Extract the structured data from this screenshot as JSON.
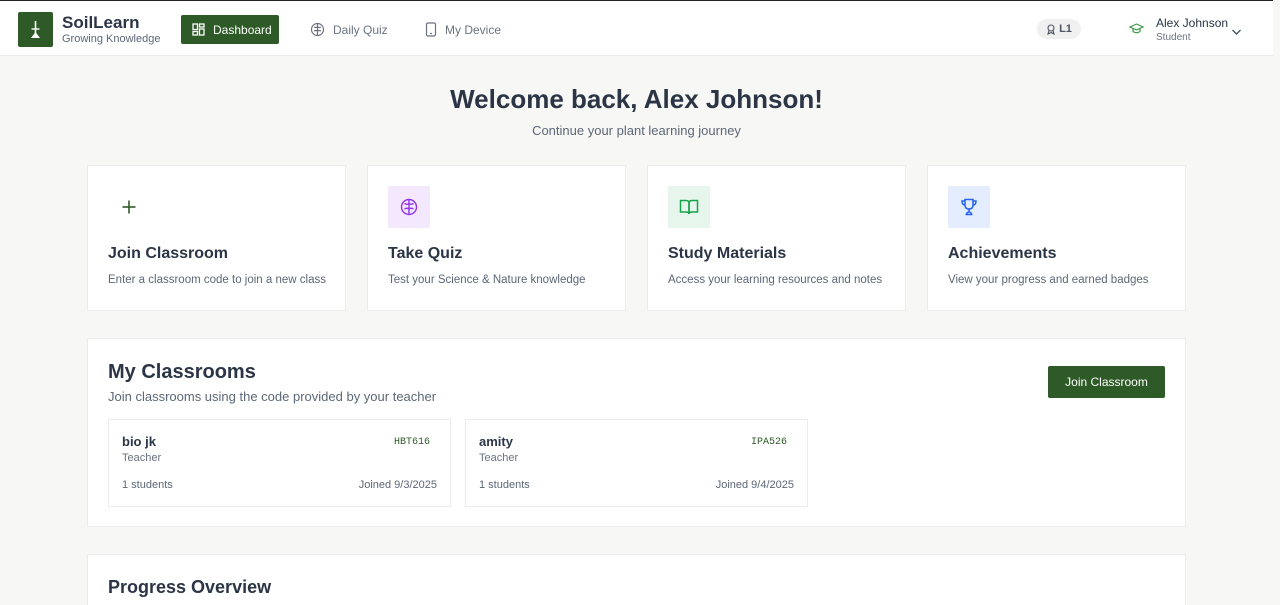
{
  "app": {
    "name": "SoilLearn",
    "tagline": "Growing Knowledge"
  },
  "nav": {
    "dashboard": "Dashboard",
    "daily_quiz": "Daily Quiz",
    "my_device": "My Device"
  },
  "user": {
    "level": "L1",
    "name": "Alex Johnson",
    "role": "Student"
  },
  "welcome": {
    "title": "Welcome back, Alex Johnson!",
    "subtitle": "Continue your plant learning journey"
  },
  "actions": [
    {
      "title": "Join Classroom",
      "desc": "Enter a classroom code to join a new class",
      "icon": "plus-icon"
    },
    {
      "title": "Take Quiz",
      "desc": "Test your Science & Nature knowledge",
      "icon": "brain-icon"
    },
    {
      "title": "Study Materials",
      "desc": "Access your learning resources and notes",
      "icon": "book-icon"
    },
    {
      "title": "Achievements",
      "desc": "View your progress and earned badges",
      "icon": "trophy-icon"
    }
  ],
  "classrooms": {
    "title": "My Classrooms",
    "subtitle": "Join classrooms using the code provided by your teacher",
    "join_button": "Join Classroom",
    "items": [
      {
        "name": "bio jk",
        "role": "Teacher",
        "code": "HBT616",
        "students": "1 students",
        "joined": "Joined 9/3/2025"
      },
      {
        "name": "amity",
        "role": "Teacher",
        "code": "IPA526",
        "students": "1 students",
        "joined": "Joined 9/4/2025"
      }
    ]
  },
  "progress": {
    "title": "Progress Overview"
  },
  "colors": {
    "brand": "#2e5a27",
    "text": "#2b3545",
    "quiz_tint": "#f3e8fd",
    "study_tint": "#e6f6ec",
    "achieve_tint": "#e3edfd"
  }
}
